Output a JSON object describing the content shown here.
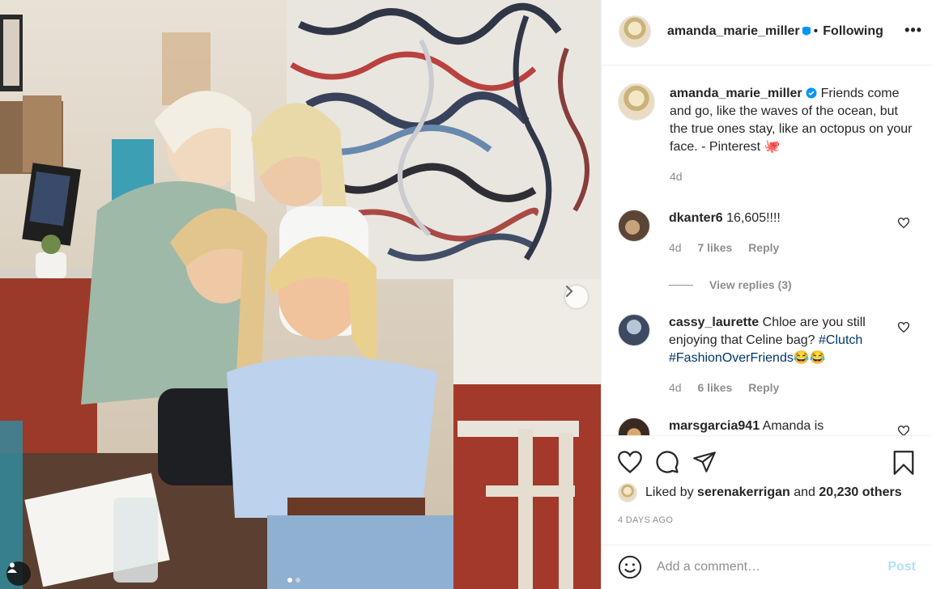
{
  "post": {
    "username": "amanda_marie_miller",
    "dot": "•",
    "follow_status": "Following",
    "more": "•••"
  },
  "caption": {
    "username": "amanda_marie_miller",
    "text": "Friends come and go, like the waves of the ocean, but the true ones stay, like an octopus on your face. - Pinterest",
    "emoji": "🐙",
    "age": "4d"
  },
  "comments": [
    {
      "username": "dkanter6",
      "text": "16,605!!!!",
      "age": "4d",
      "likes": "7 likes",
      "reply": "Reply",
      "view_replies": "View replies (3)"
    },
    {
      "username": "cassy_laurette",
      "text": "Chloe are you still enjoying that Celine bag?",
      "tag1": "#Clutch",
      "tag2": "#FashionOverFriends",
      "emoji": "😂😂",
      "age": "4d",
      "likes": "6 likes",
      "reply": "Reply"
    },
    {
      "username": "marsgarcia941",
      "text": "Amanda is"
    }
  ],
  "engagement": {
    "liked_by_prefix": "Liked by",
    "liked_by_user": "serenakerrigan",
    "and": "and",
    "others": "20,230 others",
    "post_age": "4 DAYS AGO"
  },
  "composer": {
    "placeholder": "Add a comment…",
    "post_label": "Post"
  },
  "icons": {
    "like": "heart-icon",
    "comment": "comment-bubble-icon",
    "share": "paper-plane-icon",
    "save": "bookmark-icon",
    "emoji": "smiley-icon",
    "next": "chevron-right-icon",
    "tags": "user-tag-icon"
  },
  "colors": {
    "link": "#00376b",
    "muted": "#8e8e8e",
    "verified": "#0095f6",
    "post_disabled": "#b2dffc"
  }
}
